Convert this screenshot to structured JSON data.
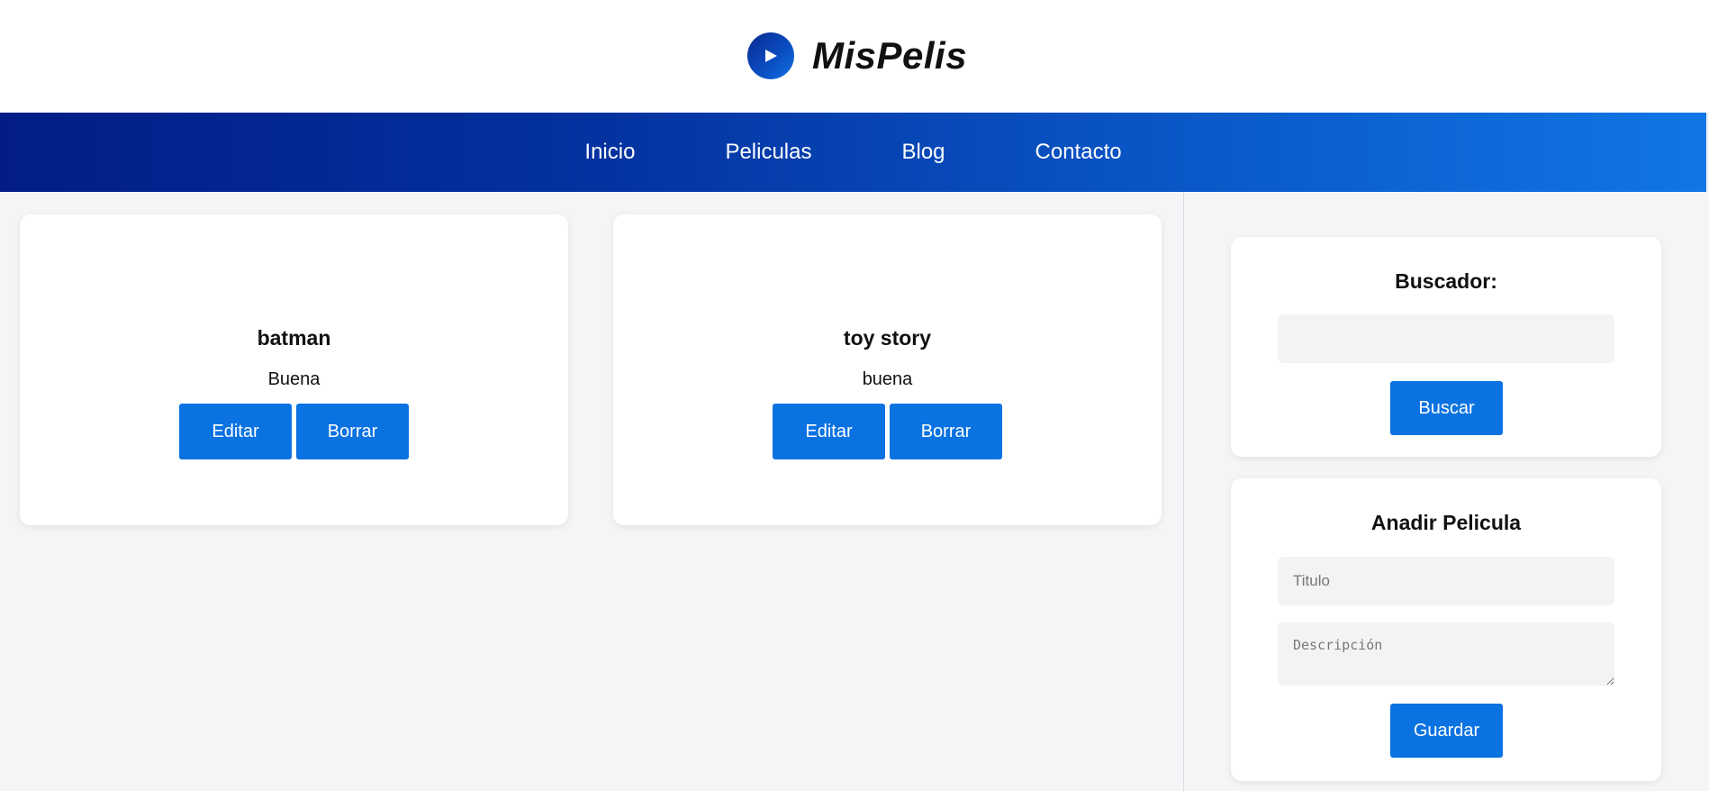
{
  "brand": {
    "title": "MisPelis"
  },
  "nav": {
    "items": [
      "Inicio",
      "Peliculas",
      "Blog",
      "Contacto"
    ]
  },
  "movies": [
    {
      "title": "batman",
      "description": "Buena",
      "edit_label": "Editar",
      "delete_label": "Borrar"
    },
    {
      "title": "toy story",
      "description": "buena",
      "edit_label": "Editar",
      "delete_label": "Borrar"
    }
  ],
  "search": {
    "title": "Buscador:",
    "value": "",
    "button_label": "Buscar"
  },
  "add_movie": {
    "title": "Anadir Pelicula",
    "title_placeholder": "Titulo",
    "description_placeholder": "Descripción",
    "save_label": "Guardar"
  },
  "colors": {
    "accent": "#0b72e1",
    "nav_start": "#021d86",
    "nav_end": "#1176e6",
    "background": "#f4f5f7"
  },
  "icons": {
    "logo": "play-icon"
  }
}
